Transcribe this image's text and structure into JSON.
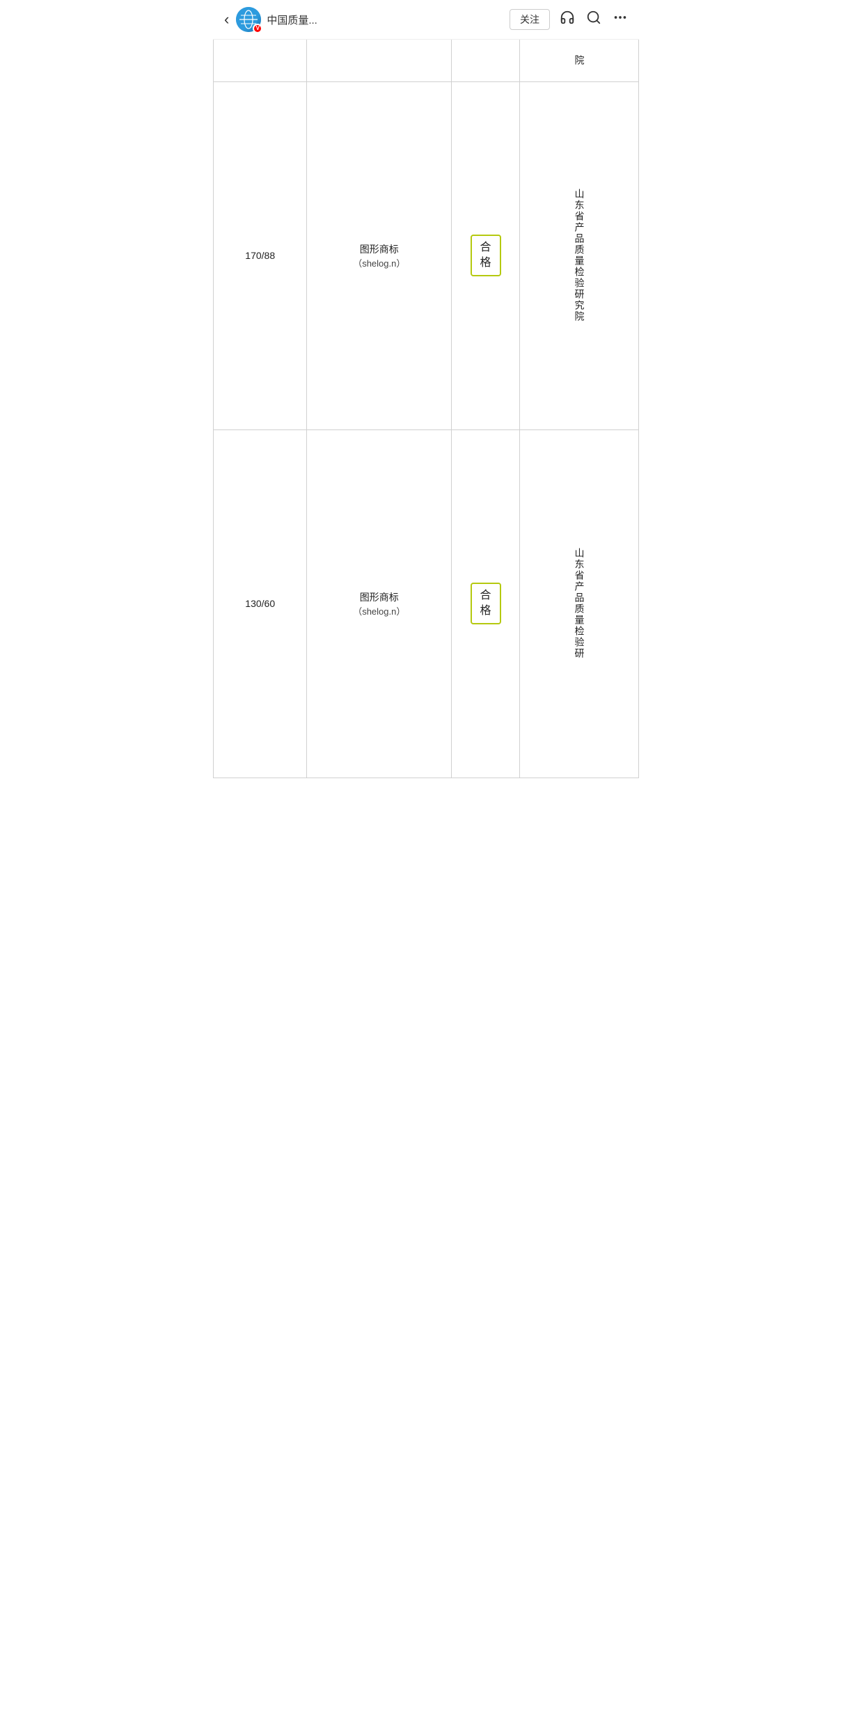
{
  "nav": {
    "back_icon": "‹",
    "account_name": "中国质量...",
    "follow_label": "关注",
    "headphone_icon": "headphone",
    "search_icon": "search",
    "more_icon": "more",
    "avatar_badge": "V"
  },
  "table": {
    "rows": [
      {
        "id": "row-partial-top",
        "size": "",
        "mark": "",
        "mark_sub": "",
        "result": "",
        "org_partial": "院"
      },
      {
        "id": "row-1",
        "size": "170/88",
        "mark": "图形商标",
        "mark_sub": "（shelog.n）",
        "result": "合\n格",
        "org": "山东省产品质量检验研究院"
      },
      {
        "id": "row-2",
        "size": "130/60",
        "mark": "图形商标",
        "mark_sub": "（shelog.n）",
        "result": "合\n格",
        "org": "山东省产品质量检验研"
      }
    ],
    "badge_color": "#b5c910"
  }
}
